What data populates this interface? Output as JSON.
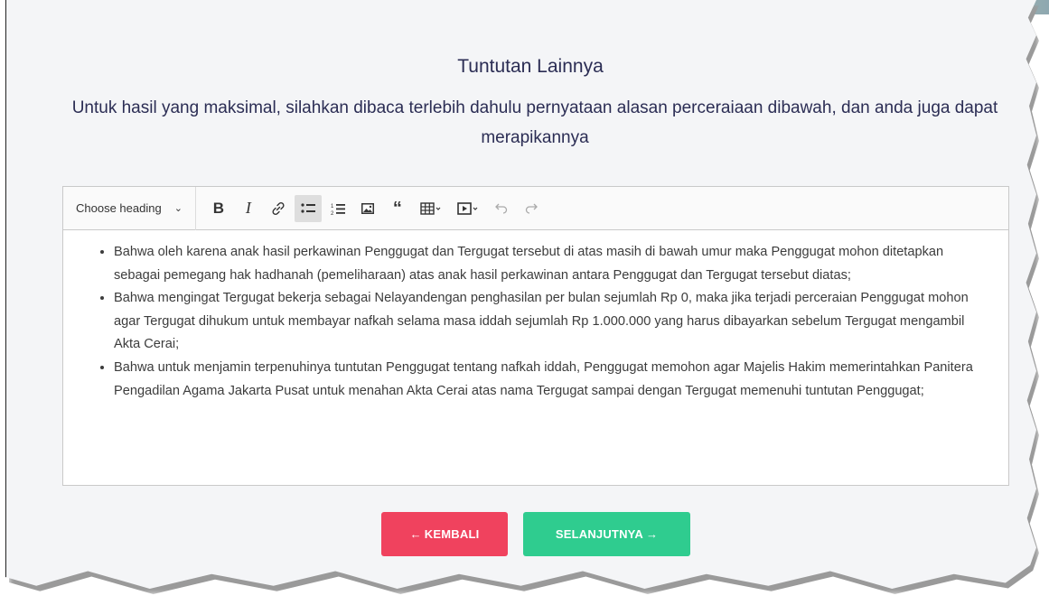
{
  "section": {
    "title": "Tuntutan Lainnya",
    "subtitle": "Untuk hasil yang maksimal, silahkan dibaca terlebih dahulu pernyataan alasan perceraiaan dibawah, dan anda juga dapat merapikannya"
  },
  "editor": {
    "toolbar": {
      "heading_select": "Choose heading",
      "icons": [
        "bold-icon",
        "italic-icon",
        "link-icon",
        "bulleted-list-icon",
        "numbered-list-icon",
        "image-icon",
        "blockquote-icon",
        "table-icon",
        "media-icon",
        "undo-icon",
        "redo-icon"
      ],
      "active": "bulleted-list-icon"
    },
    "items": [
      "Bahwa oleh karena anak hasil perkawinan Penggugat dan Tergugat tersebut di atas masih di bawah umur maka Penggugat mohon ditetapkan sebagai pemegang hak hadhanah (pemeliharaan) atas anak hasil perkawinan antara Penggugat dan Tergugat tersebut diatas;",
      "Bahwa mengingat Tergugat bekerja sebagai Nelayandengan penghasilan per bulan sejumlah Rp 0, maka jika terjadi perceraian Penggugat mohon agar Tergugat dihukum untuk membayar nafkah selama masa iddah sejumlah Rp 1.000.000 yang harus dibayarkan sebelum Tergugat mengambil Akta Cerai;",
      "Bahwa untuk menjamin terpenuhinya tuntutan Penggugat tentang nafkah iddah, Penggugat memohon agar Majelis Hakim memerintahkan Panitera Pengadilan Agama Jakarta Pusat untuk menahan Akta Cerai atas nama Tergugat sampai dengan Tergugat memenuhi tuntutan Penggugat;"
    ]
  },
  "buttons": {
    "back": "KEMBALI",
    "next": "SELANJUTNYA"
  },
  "colors": {
    "title": "#2b2d54",
    "back_button": "#f0425e",
    "next_button": "#2fcc8f"
  }
}
